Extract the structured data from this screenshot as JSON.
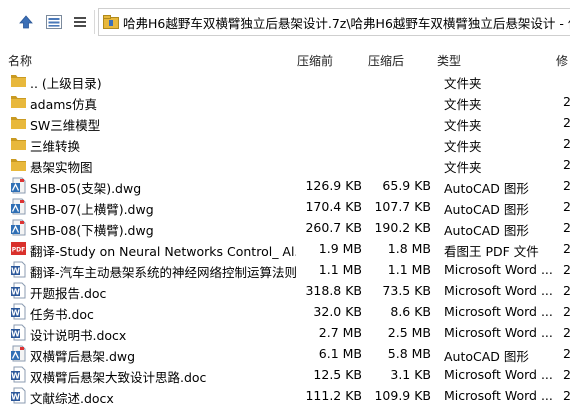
{
  "toolbar": {
    "path": "哈弗H6越野车双横臂独立后悬架设计.7z\\哈弗H6越野车双横臂独立后悬架设计 - 俳"
  },
  "columns": {
    "name": "名称",
    "packed": "压缩前",
    "size": "压缩后",
    "type": "类型",
    "modified": "修"
  },
  "rows": [
    {
      "name": ".. (上级目录)",
      "packed": "",
      "size": "",
      "type": "文件夹",
      "modified": "",
      "icon": "folder-icon"
    },
    {
      "name": "adams仿真",
      "packed": "",
      "size": "",
      "type": "文件夹",
      "modified": "2",
      "icon": "folder-icon"
    },
    {
      "name": "SW三维模型",
      "packed": "",
      "size": "",
      "type": "文件夹",
      "modified": "2",
      "icon": "folder-icon"
    },
    {
      "name": "三维转换",
      "packed": "",
      "size": "",
      "type": "文件夹",
      "modified": "2",
      "icon": "folder-icon"
    },
    {
      "name": "悬架实物图",
      "packed": "",
      "size": "",
      "type": "文件夹",
      "modified": "2",
      "icon": "folder-icon"
    },
    {
      "name": "SHB-05(支架).dwg",
      "packed": "126.9 KB",
      "size": "65.9 KB",
      "type": "AutoCAD 图形",
      "modified": "2",
      "icon": "dwg-file-icon"
    },
    {
      "name": "SHB-07(上横臂).dwg",
      "packed": "170.4 KB",
      "size": "107.7 KB",
      "type": "AutoCAD 图形",
      "modified": "2",
      "icon": "dwg-file-icon"
    },
    {
      "name": "SHB-08(下横臂).dwg",
      "packed": "260.7 KB",
      "size": "190.2 KB",
      "type": "AutoCAD 图形",
      "modified": "2",
      "icon": "dwg-file-icon"
    },
    {
      "name": "翻译-Study on Neural Networks Control_ Al...",
      "packed": "1.9 MB",
      "size": "1.8 MB",
      "type": "看图王 PDF 文件",
      "modified": "2",
      "icon": "pdf-file-icon"
    },
    {
      "name": "翻译-汽车主动悬架系统的神经网络控制运算法则...",
      "packed": "1.1 MB",
      "size": "1.1 MB",
      "type": "Microsoft Word ...",
      "modified": "2",
      "icon": "word-file-icon"
    },
    {
      "name": "开题报告.doc",
      "packed": "318.8 KB",
      "size": "73.5 KB",
      "type": "Microsoft Word ...",
      "modified": "2",
      "icon": "word-file-icon"
    },
    {
      "name": "任务书.doc",
      "packed": "32.0 KB",
      "size": "8.6 KB",
      "type": "Microsoft Word ...",
      "modified": "2",
      "icon": "word-file-icon"
    },
    {
      "name": "设计说明书.docx",
      "packed": "2.7 MB",
      "size": "2.5 MB",
      "type": "Microsoft Word ...",
      "modified": "2",
      "icon": "word-file-icon"
    },
    {
      "name": "双横臂后悬架.dwg",
      "packed": "6.1 MB",
      "size": "5.8 MB",
      "type": "AutoCAD 图形",
      "modified": "2",
      "icon": "dwg-file-icon"
    },
    {
      "name": "双横臂后悬架大致设计思路.doc",
      "packed": "12.5 KB",
      "size": "3.1 KB",
      "type": "Microsoft Word ...",
      "modified": "2",
      "icon": "word-file-icon"
    },
    {
      "name": "文献综述.docx",
      "packed": "111.2 KB",
      "size": "109.9 KB",
      "type": "Microsoft Word ...",
      "modified": "2",
      "icon": "word-file-icon"
    }
  ],
  "colors": {
    "folder": "#e8b83c",
    "folder_dark": "#c99a22",
    "word": "#2b579a",
    "pdf": "#d9302b",
    "dwg_blue": "#2f6fb5"
  }
}
